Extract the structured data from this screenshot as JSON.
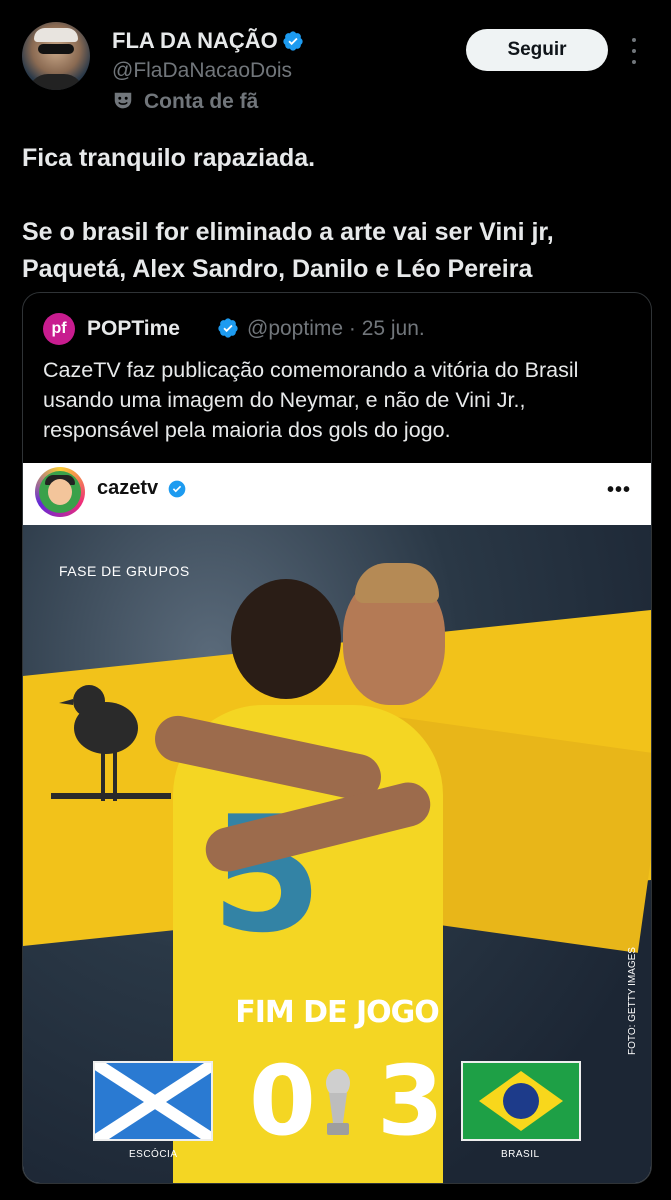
{
  "author": {
    "name": "FLA DA NAÇÃO",
    "handle": "@FlaDaNacaoDois",
    "badge": "Conta de fã",
    "follow_label": "Seguir"
  },
  "tweet": {
    "line1": "Fica tranquilo rapaziada.",
    "line2": "Se o brasil for eliminado a arte vai ser Vini jr, Paquetá, Alex Sandro, Danilo e Léo Pereira"
  },
  "quote": {
    "logo_text": "pf",
    "name": "POPTime",
    "meta": "@poptime · 25 jun.",
    "text": "CazeTV faz publicação comemorando a vitória do Brasil usando uma imagem do Neymar, e não de Vini Jr., responsável pela maioria dos gols do jogo."
  },
  "instagram": {
    "username": "cazetv",
    "more": "•••",
    "phase": "FASE DE GRUPOS",
    "end_label": "FIM DE JOGO",
    "home_team": "ESCÓCIA",
    "home_score": "0",
    "away_team": "BRASIL",
    "away_score": "3",
    "credit": "FOTO: GETTY IMAGES"
  },
  "colors": {
    "background": "#000000",
    "verified": "#1d9bf0",
    "muted": "#71767b",
    "brand_yellow": "#f2c21a"
  }
}
